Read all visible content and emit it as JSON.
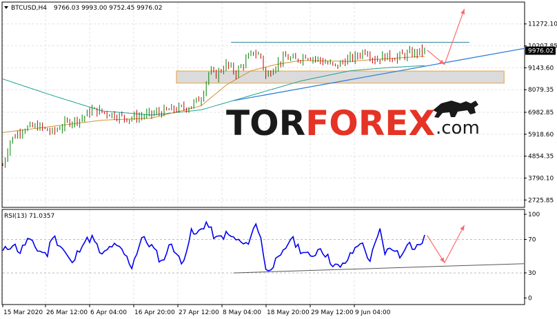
{
  "chart_data": [
    {
      "type": "candlestick",
      "symbol_header": "BTCUSD,H4",
      "ohlc_header": "9766.03 9993.00 9752.45 9976.02",
      "current_price_label": "9976.02",
      "ylim": [
        2400,
        12300
      ],
      "y_ticks": [
        "11272.10",
        "10207.85",
        "9143.60",
        "8079.35",
        "6982.85",
        "5918.60",
        "4854.35",
        "3790.10",
        "2725.85"
      ],
      "y_tick_values": [
        11272.1,
        10207.85,
        9143.6,
        8079.35,
        6982.85,
        5918.6,
        4854.35,
        3790.1,
        2725.85
      ],
      "x_tick_labels": [
        "15 Mar 2020",
        "26 Mar 12:00",
        "6 Apr 04:00",
        "16 Apr 20:00",
        "27 Apr 12:00",
        "8 May 04:00",
        "18 May 20:00",
        "29 May 12:00",
        "9 Jun 04:00"
      ],
      "close_keypoints": [
        [
          0,
          4400
        ],
        [
          3,
          5600
        ],
        [
          8,
          6200
        ],
        [
          14,
          6300
        ],
        [
          20,
          6000
        ],
        [
          26,
          6500
        ],
        [
          32,
          6700
        ],
        [
          36,
          7100
        ],
        [
          42,
          6950
        ],
        [
          50,
          6700
        ],
        [
          56,
          6800
        ],
        [
          62,
          6950
        ],
        [
          68,
          7100
        ],
        [
          75,
          7250
        ],
        [
          80,
          7700
        ],
        [
          83,
          8900
        ],
        [
          86,
          8800
        ],
        [
          90,
          9300
        ],
        [
          94,
          8900
        ],
        [
          98,
          9500
        ],
        [
          101,
          9900
        ],
        [
          104,
          9700
        ],
        [
          106,
          8700
        ],
        [
          110,
          9300
        ],
        [
          114,
          9650
        ],
        [
          118,
          9500
        ],
        [
          122,
          9750
        ],
        [
          126,
          9600
        ],
        [
          130,
          9400
        ],
        [
          134,
          9200
        ],
        [
          138,
          9500
        ],
        [
          142,
          9650
        ],
        [
          146,
          10000
        ],
        [
          150,
          9550
        ],
        [
          154,
          9700
        ],
        [
          158,
          9650
        ],
        [
          163,
          9800
        ],
        [
          167,
          9900
        ],
        [
          170,
          9976
        ]
      ],
      "ma_slow_keypoints": [
        [
          0,
          8600
        ],
        [
          20,
          7800
        ],
        [
          40,
          7050
        ],
        [
          60,
          6850
        ],
        [
          80,
          7100
        ],
        [
          100,
          7800
        ],
        [
          120,
          8500
        ],
        [
          140,
          9000
        ],
        [
          155,
          9150
        ],
        [
          170,
          9250
        ]
      ],
      "ma_fast_keypoints": [
        [
          0,
          6000
        ],
        [
          20,
          6300
        ],
        [
          40,
          6600
        ],
        [
          60,
          6700
        ],
        [
          80,
          7300
        ],
        [
          90,
          8300
        ],
        [
          100,
          9000
        ],
        [
          110,
          9300
        ],
        [
          120,
          9500
        ],
        [
          140,
          9450
        ],
        [
          150,
          9550
        ],
        [
          170,
          9700
        ]
      ],
      "resistance_level": 10380,
      "support_zone": [
        8400,
        8980
      ],
      "trendline_points": [
        [
          93,
          7550
        ],
        [
          210,
          10080
        ]
      ],
      "forecast_arrows": [
        {
          "from": [
            171,
            10000
          ],
          "to": [
            178,
            9300
          ]
        },
        {
          "from": [
            178,
            9300
          ],
          "to": [
            186,
            12000
          ]
        }
      ],
      "colors": {
        "up": "#c00000",
        "down": "#008000",
        "ma_slow": "#20a090",
        "ma_fast": "#d09030",
        "resistance": "#2a7fa0",
        "support_fill": "#d8d8d8",
        "support_border": "#e8b060",
        "trendline": "#2f7fd8",
        "arrow": "#ff6a6a"
      }
    },
    {
      "type": "line",
      "header": "RSI(13) 71.0357",
      "ylim": [
        0,
        100
      ],
      "y_ticks": [
        "100",
        "70",
        "30",
        "0"
      ],
      "y_tick_values": [
        100,
        70,
        30,
        0
      ],
      "levels": [
        70,
        30
      ],
      "keypoints": [
        [
          0,
          55
        ],
        [
          4,
          65
        ],
        [
          7,
          55
        ],
        [
          10,
          70
        ],
        [
          14,
          58
        ],
        [
          18,
          52
        ],
        [
          20,
          75
        ],
        [
          24,
          60
        ],
        [
          28,
          40
        ],
        [
          32,
          66
        ],
        [
          36,
          72
        ],
        [
          40,
          50
        ],
        [
          44,
          63
        ],
        [
          48,
          57
        ],
        [
          52,
          38
        ],
        [
          56,
          72
        ],
        [
          60,
          62
        ],
        [
          64,
          43
        ],
        [
          68,
          66
        ],
        [
          72,
          40
        ],
        [
          76,
          78
        ],
        [
          78,
          75
        ],
        [
          80,
          83
        ],
        [
          82,
          90
        ],
        [
          86,
          70
        ],
        [
          90,
          76
        ],
        [
          94,
          70
        ],
        [
          98,
          62
        ],
        [
          102,
          88
        ],
        [
          104,
          74
        ],
        [
          106,
          32
        ],
        [
          108,
          38
        ],
        [
          112,
          48
        ],
        [
          116,
          72
        ],
        [
          120,
          58
        ],
        [
          124,
          48
        ],
        [
          128,
          61
        ],
        [
          132,
          44
        ],
        [
          136,
          35
        ],
        [
          140,
          50
        ],
        [
          144,
          68
        ],
        [
          148,
          45
        ],
        [
          152,
          80
        ],
        [
          154,
          55
        ],
        [
          158,
          60
        ],
        [
          160,
          48
        ],
        [
          163,
          68
        ],
        [
          166,
          58
        ],
        [
          170,
          71
        ]
      ],
      "trendline_points": [
        [
          93,
          30
        ],
        [
          210,
          41
        ]
      ],
      "forecast_arrows": [
        {
          "from": [
            171,
            75
          ],
          "to": [
            178,
            42
          ]
        },
        {
          "from": [
            178,
            42
          ],
          "to": [
            186,
            87
          ]
        }
      ],
      "colors": {
        "line": "#0000ee",
        "level": "#bbbbbb",
        "trendline": "#555555",
        "arrow": "#ff6a6a"
      }
    }
  ],
  "watermark": {
    "part1": "TOR",
    "part2": "FOREX",
    "suffix": ".com",
    "color_dark": "#1a1a1a",
    "color_accent": "#e53325"
  }
}
